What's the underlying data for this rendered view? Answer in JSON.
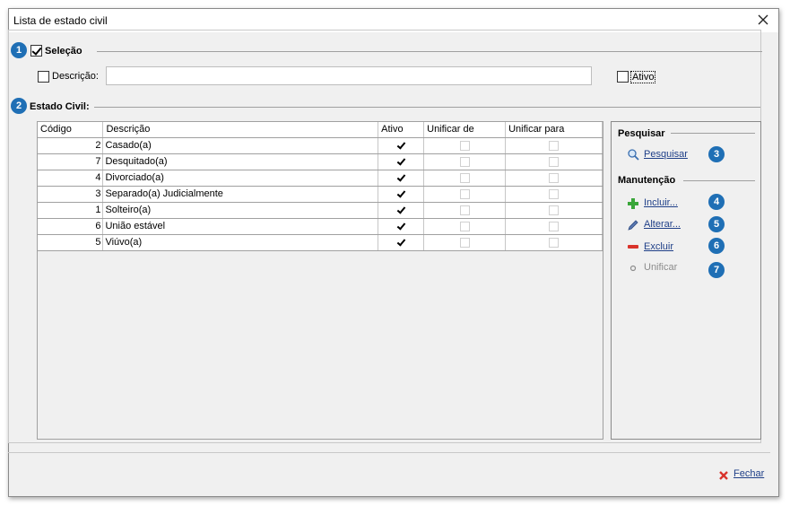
{
  "window": {
    "title": "Lista de estado civil"
  },
  "selection": {
    "badge": "1",
    "label": "Seleção",
    "checked": true,
    "descricao_label": "Descrição:",
    "descricao_value": "",
    "ativo_label": "Ativo"
  },
  "estado_civil": {
    "badge": "2",
    "label": "Estado Civil:",
    "columns": [
      "Código",
      "Descrição",
      "Ativo",
      "Unificar de",
      "Unificar para"
    ],
    "rows": [
      {
        "codigo": "2",
        "descricao": "Casado(a)",
        "ativo": true,
        "unificar_de": false,
        "unificar_para": false
      },
      {
        "codigo": "7",
        "descricao": "Desquitado(a)",
        "ativo": true,
        "unificar_de": false,
        "unificar_para": false
      },
      {
        "codigo": "4",
        "descricao": "Divorciado(a)",
        "ativo": true,
        "unificar_de": false,
        "unificar_para": false
      },
      {
        "codigo": "3",
        "descricao": "Separado(a) Judicialmente",
        "ativo": true,
        "unificar_de": false,
        "unificar_para": false
      },
      {
        "codigo": "1",
        "descricao": "Solteiro(a)",
        "ativo": true,
        "unificar_de": false,
        "unificar_para": false
      },
      {
        "codigo": "6",
        "descricao": "União estável",
        "ativo": true,
        "unificar_de": false,
        "unificar_para": false
      },
      {
        "codigo": "5",
        "descricao": "Viúvo(a)",
        "ativo": true,
        "unificar_de": false,
        "unificar_para": false
      }
    ]
  },
  "sidebar": {
    "pesquisar_title": "Pesquisar",
    "pesquisar_label": "Pesquisar",
    "pesquisar_badge": "3",
    "manutencao_title": "Manutenção",
    "incluir_label": "Incluir...",
    "incluir_badge": "4",
    "alterar_label": "Alterar...",
    "alterar_badge": "5",
    "excluir_label": "Excluir",
    "excluir_badge": "6",
    "unificar_label": "Unificar",
    "unificar_badge": "7"
  },
  "footer": {
    "fechar_label": "Fechar"
  },
  "colors": {
    "badge": "#1f6fb5",
    "link": "#1f3f88",
    "close_icon": "#d9332b",
    "add_icon": "#3aa63a"
  }
}
